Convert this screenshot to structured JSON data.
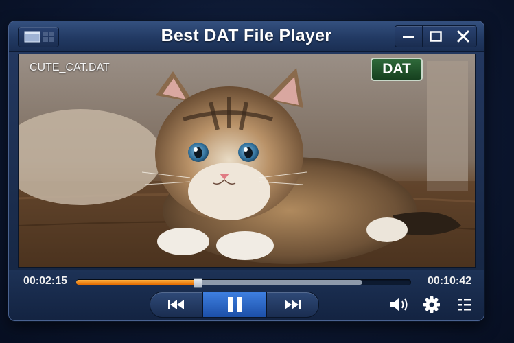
{
  "window": {
    "title": "Best DAT File Player"
  },
  "video": {
    "filename": "CUTE_CAT.DAT",
    "badge": "DAT"
  },
  "playback": {
    "current_time": "00:02:15",
    "total_time": "00:10:42",
    "progress_fraction": 0.36,
    "buffered_fraction": 0.855,
    "state": "playing"
  },
  "icons": {
    "layout": "layout-toggle-icon",
    "minimize": "minimize-icon",
    "maximize": "maximize-icon",
    "close": "close-icon",
    "previous": "skip-back-icon",
    "pause": "pause-icon",
    "next": "skip-forward-icon",
    "volume": "volume-icon",
    "settings": "gear-icon",
    "playlist": "playlist-icon"
  },
  "colors": {
    "progress": "#f07a10",
    "play_button": "#2d6bd0",
    "badge": "#1f5a2c"
  }
}
